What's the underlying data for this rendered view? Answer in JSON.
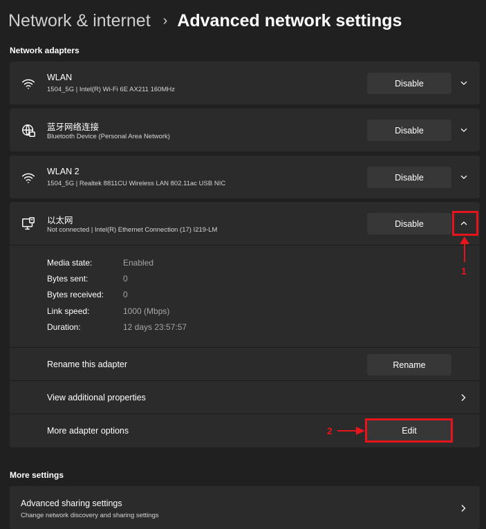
{
  "header": {
    "parent": "Network & internet",
    "separator": "›",
    "current": "Advanced network settings"
  },
  "sections": {
    "adapters_title": "Network adapters",
    "more_title": "More settings"
  },
  "adapters": [
    {
      "name": "WLAN",
      "description": "1504_5G | Intel(R) Wi-Fi 6E AX211 160MHz",
      "icon": "wifi-icon",
      "button": "Disable",
      "expanded": false
    },
    {
      "name": "蓝牙网络连接",
      "description": "Bluetooth Device (Personal Area Network)",
      "icon": "globe-network-icon",
      "button": "Disable",
      "expanded": false
    },
    {
      "name": "WLAN 2",
      "description": "1504_5G | Realtek 8811CU Wireless LAN 802.11ac USB NIC",
      "icon": "wifi-icon",
      "button": "Disable",
      "expanded": false
    },
    {
      "name": "以太网",
      "description": "Not connected | Intel(R) Ethernet Connection (17) I219-LM",
      "icon": "ethernet-icon",
      "button": "Disable",
      "expanded": true
    }
  ],
  "ethernet_details": {
    "properties": [
      {
        "label": "Media state:",
        "value": "Enabled"
      },
      {
        "label": "Bytes sent:",
        "value": "0"
      },
      {
        "label": "Bytes received:",
        "value": "0"
      },
      {
        "label": "Link speed:",
        "value": "1000 (Mbps)"
      },
      {
        "label": "Duration:",
        "value": "12 days 23:57:57"
      }
    ],
    "rename_label": "Rename this adapter",
    "rename_button": "Rename",
    "view_properties_label": "View additional properties",
    "more_options_label": "More adapter options",
    "edit_button": "Edit"
  },
  "more_settings": {
    "title": "Advanced sharing settings",
    "description": "Change network discovery and sharing settings"
  },
  "annotations": {
    "step1": "1",
    "step2": "2",
    "color": "#e8141c"
  },
  "colors": {
    "background": "#202020",
    "card": "#2b2b2b",
    "button": "#373737"
  }
}
